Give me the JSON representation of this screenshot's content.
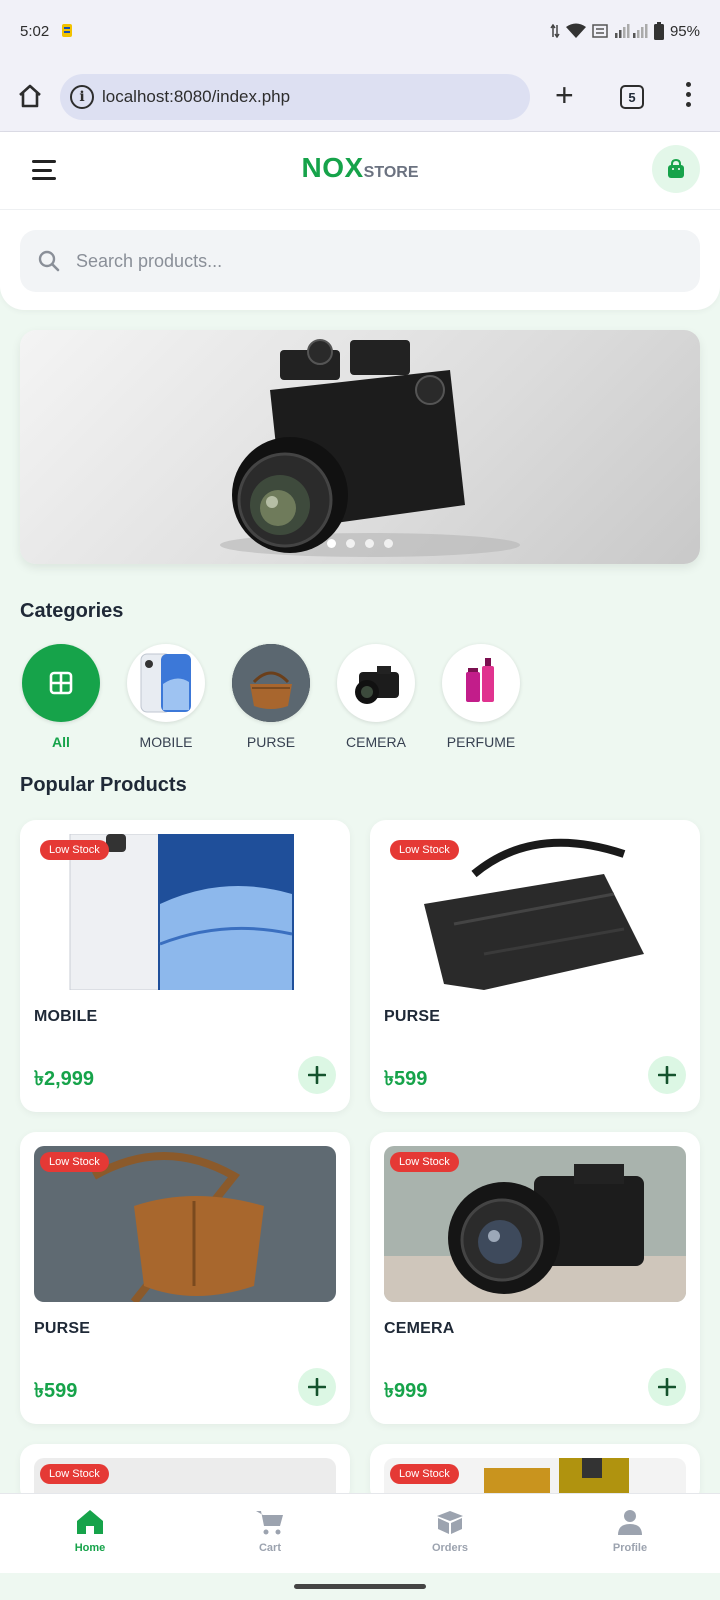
{
  "status_bar": {
    "time": "5:02",
    "battery": "95%"
  },
  "browser": {
    "url": "localhost:8080/index.php",
    "tab_count": "5"
  },
  "header": {
    "logo_main": "NOX",
    "logo_sub": "STORE"
  },
  "search": {
    "placeholder": "Search products..."
  },
  "banner": {
    "slides": 4,
    "active_slide": 1
  },
  "categories": {
    "title": "Categories",
    "items": [
      {
        "label": "All",
        "icon": "grid-icon",
        "active": true
      },
      {
        "label": "MOBILE",
        "icon": "phone-thumb"
      },
      {
        "label": "PURSE",
        "icon": "purse-thumb"
      },
      {
        "label": "CEMERA",
        "icon": "camera-thumb"
      },
      {
        "label": "PERFUME",
        "icon": "perfume-thumb"
      }
    ]
  },
  "products": {
    "title": "Popular Products",
    "badge": "Low Stock",
    "items": [
      {
        "name": "MOBILE",
        "price": "৳2,999"
      },
      {
        "name": "PURSE",
        "price": "৳599"
      },
      {
        "name": "PURSE",
        "price": "৳599"
      },
      {
        "name": "CEMERA",
        "price": "৳999"
      }
    ]
  },
  "bottom_nav": {
    "items": [
      {
        "label": "Home",
        "icon": "home-icon",
        "active": true
      },
      {
        "label": "Cart",
        "icon": "cart-icon"
      },
      {
        "label": "Orders",
        "icon": "box-icon"
      },
      {
        "label": "Profile",
        "icon": "user-icon"
      }
    ]
  },
  "colors": {
    "accent": "#16a34a",
    "badge": "#e53935",
    "background": "#eef8f1"
  }
}
